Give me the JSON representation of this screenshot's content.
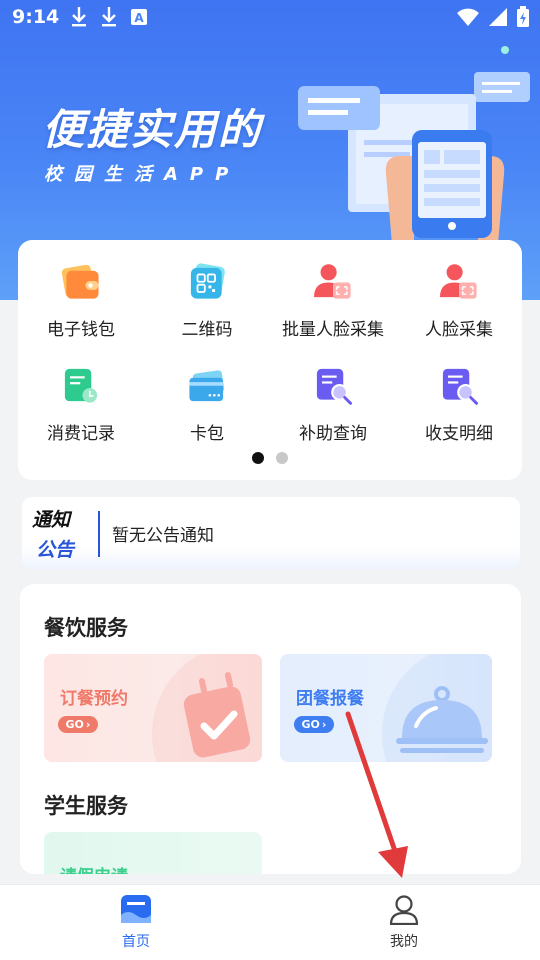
{
  "status_bar": {
    "time": "9:14",
    "left_icons": [
      "download-icon",
      "download-icon",
      "text-icon"
    ],
    "right_icons": [
      "wifi-icon",
      "signal-icon",
      "battery-charging-icon"
    ]
  },
  "banner": {
    "title": "便捷实用的",
    "subtitle": "校园生活APP"
  },
  "quick_grid": {
    "items": [
      {
        "label": "电子钱包",
        "icon": "wallet-icon"
      },
      {
        "label": "二维码",
        "icon": "qr-code-icon"
      },
      {
        "label": "批量人脸采集",
        "icon": "batch-face-capture-icon"
      },
      {
        "label": "人脸采集",
        "icon": "face-capture-icon"
      },
      {
        "label": "消费记录",
        "icon": "consumption-record-icon"
      },
      {
        "label": "卡包",
        "icon": "card-pack-icon"
      },
      {
        "label": "补助查询",
        "icon": "subsidy-query-icon"
      },
      {
        "label": "收支明细",
        "icon": "income-expense-icon"
      }
    ],
    "page_count": 2,
    "active_page": 1
  },
  "notice": {
    "badge_line1": "通知",
    "badge_line2": "公告",
    "text": "暂无公告通知"
  },
  "catering": {
    "title": "餐饮服务",
    "cards": [
      {
        "name": "订餐预约",
        "go": "GO",
        "accent": "#f07a6a"
      },
      {
        "name": "团餐报餐",
        "go": "GO",
        "accent": "#3f7ef0"
      }
    ]
  },
  "student": {
    "title": "学生服务",
    "cards": [
      {
        "name": "请假申请",
        "accent": "#3ccf8e"
      }
    ]
  },
  "bottom_nav": {
    "tabs": [
      {
        "label": "首页",
        "icon": "home-icon",
        "active": true
      },
      {
        "label": "我的",
        "icon": "profile-icon",
        "active": false
      }
    ]
  },
  "colors": {
    "primary": "#2a6cf0",
    "annotation_arrow": "#e03a3a"
  }
}
